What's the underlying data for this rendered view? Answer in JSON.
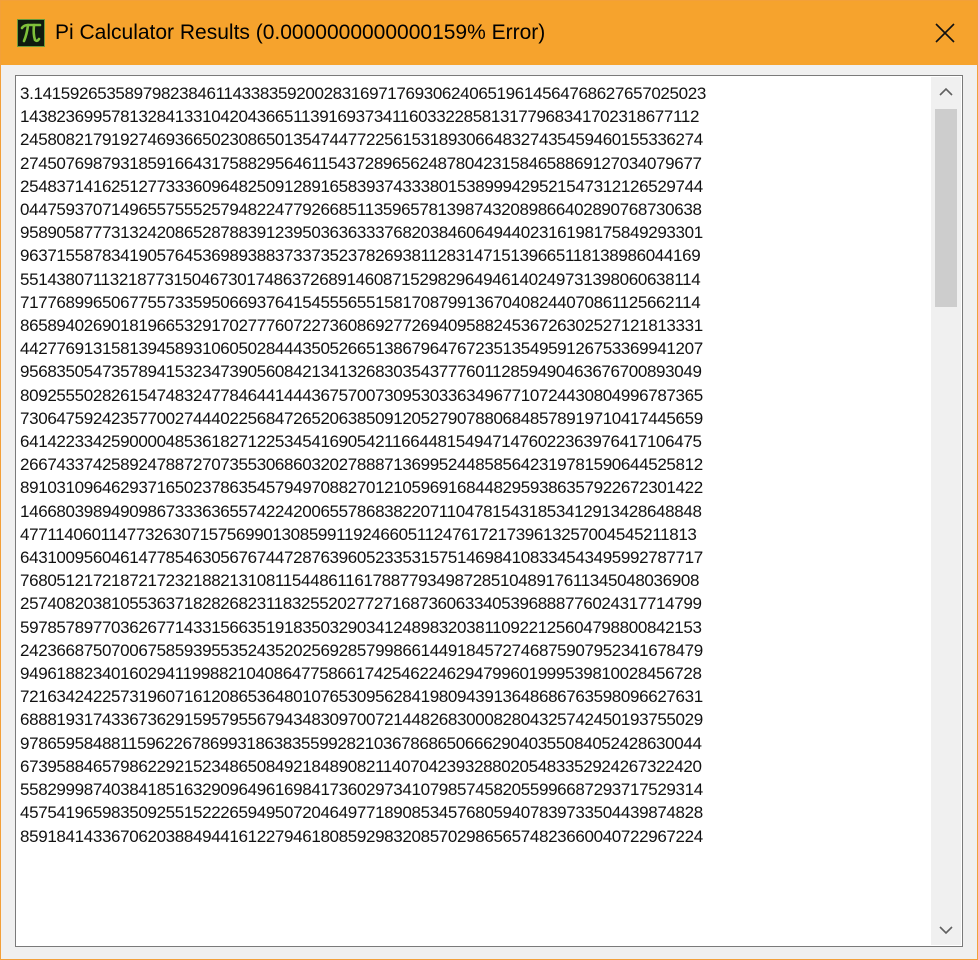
{
  "window": {
    "title": "Pi Calculator Results (0.0000000000000159% Error)"
  },
  "icons": {
    "app": "pi-icon",
    "close": "close-icon",
    "scroll_up": "chevron-up-icon",
    "scroll_down": "chevron-down-icon"
  },
  "colors": {
    "titlebar": "#f6a32d",
    "icon_bg": "#0f1a0f",
    "icon_glyph": "#7fc13a"
  },
  "scroll": {
    "thumb_position": 0.0
  },
  "result": {
    "lines": [
      "3.14159265358979823846114338359200283169717693062406519614564768627657025023",
      "14382369957813284133104204366511391693734116033228581317796834170231867711 2",
      "24580821791927469366502308650135474477225615318930664832743545946015533627 4",
      "27450769879318591664317588295646115437289656248780423158465886912703407967 7",
      "25483714162512773336096482509128916583937433380153899942952154731212652974 4",
      "04475937071496557555257948224779266851135965781398743208986640289076873063 8",
      "95890587773132420865287883912395036363337682038460649440231619817584929330 1",
      "96371558783419057645369893883733735237826938112831471513966511813898604416 9",
      "55143807113218773150467301748637268914608715298296494614024973139806063811 4",
      "71776899650677557335950669376415455565515817087991367040824407086112566211 4",
      "86589402690181966532917027776072273608692772694095882453672630252712181333 1",
      "44277691315813945893106050284443505266513867964767235135495912675336994120 7",
      "95683505473578941532347390560842134132683035437776011285949046367670089304 9",
      "80925550282615474832477846441444367570073095303363496771072443080499678736 5",
      "73064759242357700274440225684726520638509120527907880684857891971041744565 9",
      "64142233425900004853618271225345416905421166448154947147602236397641710647 5",
      "26674337425892478872707355306860320278887136995244858564231978159064452581 2",
      "89103109646293716502378635457949708827012105969168448295938635792267230142 2",
      "14668039894909867333636557422420065578683822071104781543185341291342864884 8",
      "47711406011477326307157569901308599119246605112476172173961325700454521181 3",
      "64310095604614778546305676744728763960523353157514698410833454349599278771 7",
      "76805121721872172321882131081154486116178877934987285104891761134504803690 8",
      "25740820381055363718282682311832552027727168736063340539688877602431771479 9",
      "59785789770362677143315663519183503290341248983203811092212560479880084215 3",
      "24236687507006758593955352435202569285799866144918457274687590795234167847 9",
      "94961882340160294119988210408647758661742546224629479960199953981002845672 8",
      "72163424225731960716120865364801076530956284198094391364868676359809662763 1",
      "68881931743367362915957955679434830970072144826830008280432574245019375502 9",
      "97865958488115962267869931863835599282103678686506662904035508405242863004 4",
      "67395884657986229215234865084921848908211407042393288020548335292426732242 0",
      "55829998740384185163290964961698417360297341079857458205599668729371752931 4",
      "45754196598350925515222659495072046497718908534576805940783973350443987482 8",
      "85918414336706203884944161227946180859298320857029865657482366004072296722 4"
    ]
  }
}
